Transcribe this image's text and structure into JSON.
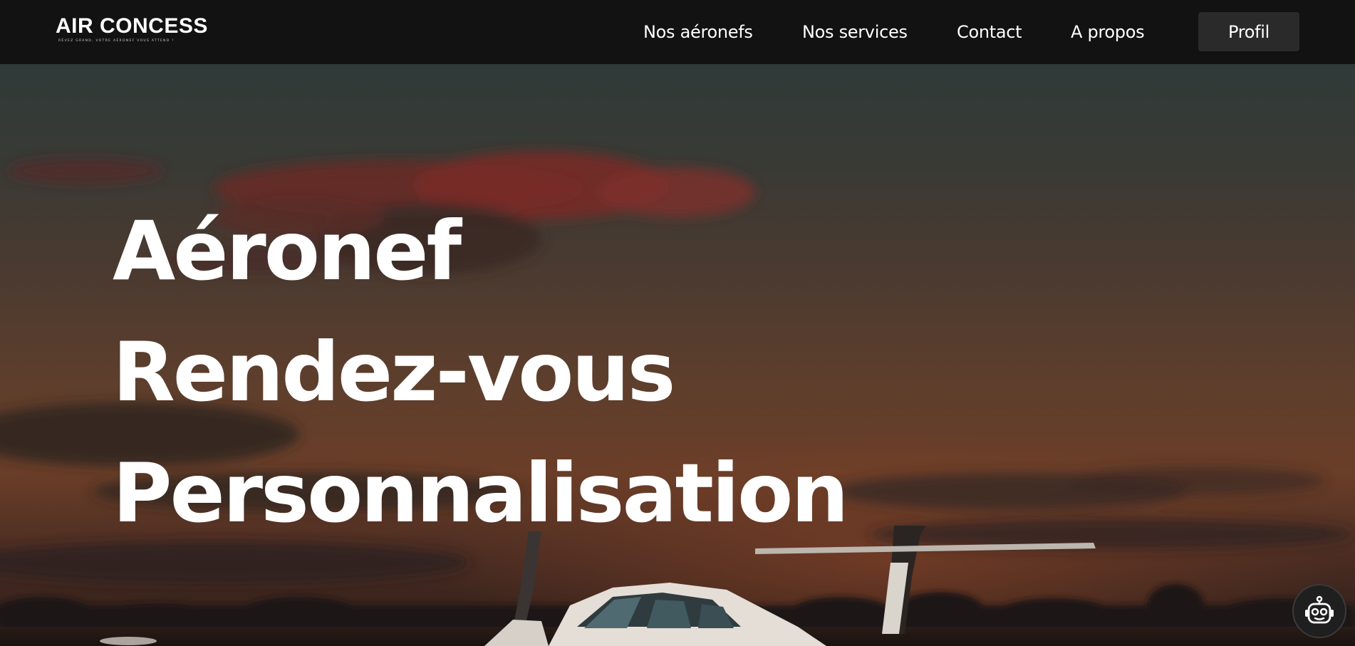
{
  "brand": {
    "name": "AIR CONCESS",
    "tagline": "Rêvez grand, votre aéronef vous attend !"
  },
  "nav": {
    "links": [
      "Nos aéronefs",
      "Nos services",
      "Contact",
      "A propos"
    ],
    "profile_label": "Profil"
  },
  "hero": {
    "lines": [
      "Aéronef",
      "Rendez-vous",
      "Personnalisation"
    ]
  },
  "icons": {
    "chatbot": "robot-icon"
  },
  "colors": {
    "navbar": "#121212",
    "profile_button": "#2a2a2a",
    "text": "#ffffff"
  }
}
